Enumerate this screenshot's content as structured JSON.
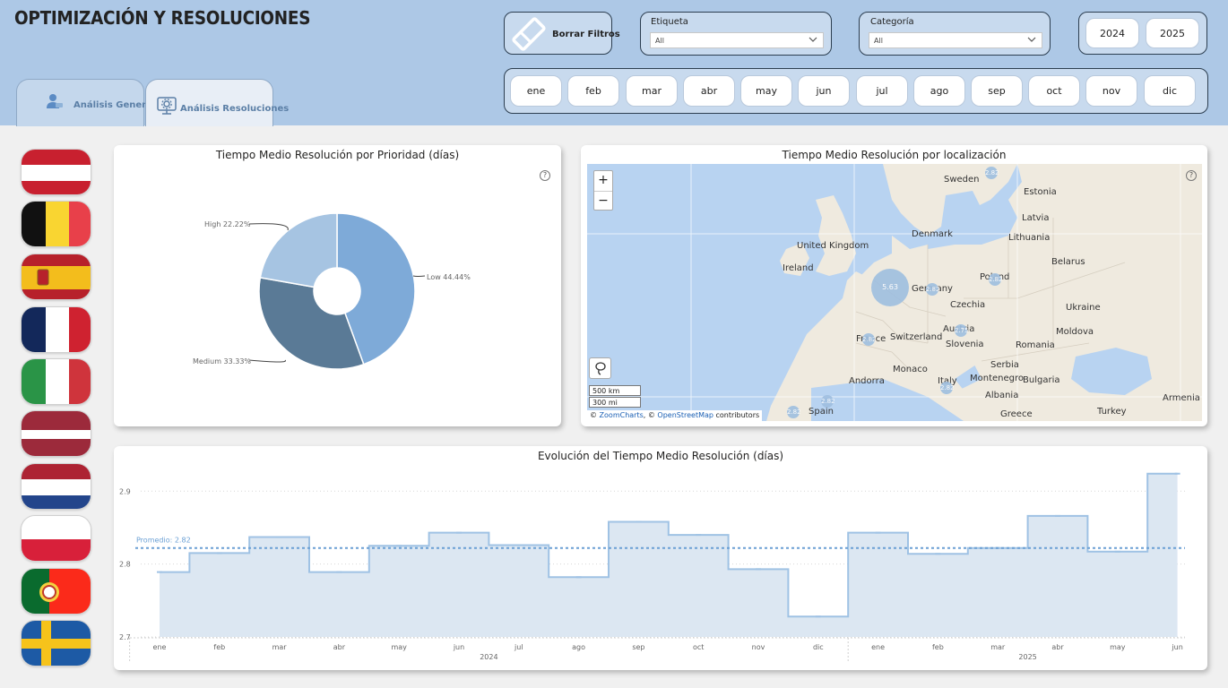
{
  "header": {
    "title": "OPTIMIZACIÓN Y RESOLUCIONES",
    "tabs": [
      {
        "label": "Análisis General",
        "active": false
      },
      {
        "label": "Análisis Resoluciones",
        "active": true
      }
    ],
    "clear_filters_label": "Borrar Filtros",
    "etiqueta": {
      "label": "Etiqueta",
      "value": "All"
    },
    "categoria": {
      "label": "Categoría",
      "value": "All"
    },
    "years": [
      "2024",
      "2025"
    ],
    "months": [
      "ene",
      "feb",
      "mar",
      "abr",
      "may",
      "jun",
      "jul",
      "ago",
      "sep",
      "oct",
      "nov",
      "dic"
    ]
  },
  "flags": [
    "austria-flag",
    "belgium-flag",
    "spain-flag",
    "france-flag",
    "italy-flag",
    "latvia-flag",
    "netherlands-flag",
    "poland-flag",
    "portugal-flag",
    "sweden-flag"
  ],
  "colors": {
    "header_bg": "#adc8e6",
    "low": "#7eaad8",
    "medium": "#5a7a96",
    "high": "#a6c4e2",
    "line": "#9fc2e4",
    "area": "#dce7f2",
    "avg": "#6a9fd4"
  },
  "donut": {
    "title": "Tiempo Medio Resolución por Prioridad (días)",
    "slices": [
      {
        "label": "Low 44.44%",
        "name": "Low",
        "value": 44.44,
        "color": "#7eaad8"
      },
      {
        "label": "Medium 33.33%",
        "name": "Medium",
        "value": 33.33,
        "color": "#5a7a96"
      },
      {
        "label": "High 22.22%",
        "name": "High",
        "value": 22.22,
        "color": "#a6c4e2"
      }
    ]
  },
  "map": {
    "title": "Tiempo Medio Resolución por localización",
    "zoom_in": "+",
    "zoom_out": "−",
    "scale_km": "500 km",
    "scale_mi": "300 mi",
    "attribution": {
      "prefix": "© ",
      "zoomcharts": "ZoomCharts",
      "sep": ", © ",
      "osm": "OpenStreetMap",
      "suffix": " contributors"
    },
    "countries": [
      "Sweden",
      "Estonia",
      "Latvia",
      "Denmark",
      "Lithuania",
      "United Kingdom",
      "Ireland",
      "Belarus",
      "Poland",
      "Germany",
      "Czechia",
      "Ukraine",
      "France",
      "Switzerland",
      "Austria",
      "Slovenia",
      "Moldova",
      "Romania",
      "Monaco",
      "Serbia",
      "Andorra",
      "Italy",
      "Montenegro",
      "Bulgaria",
      "Albania",
      "Spain",
      "Greece",
      "Turkey",
      "Armenia"
    ],
    "bubbles": [
      {
        "name": "bubble-belgium",
        "value": "5.63"
      },
      {
        "name": "bubble-sweden",
        "value": "2.82"
      },
      {
        "name": "bubble-germany",
        "value": "2.82"
      },
      {
        "name": "bubble-poland",
        "value": "2.82"
      },
      {
        "name": "bubble-france",
        "value": "2.82"
      },
      {
        "name": "bubble-austria",
        "value": "2.75"
      },
      {
        "name": "bubble-italy",
        "value": "2.82"
      },
      {
        "name": "bubble-spain",
        "value": "2.82"
      },
      {
        "name": "bubble-portugal",
        "value": "2.82"
      }
    ]
  },
  "chart_data": {
    "type": "area",
    "title": "Evolución del Tiempo Medio Resolución (días)",
    "categories": [
      "ene",
      "feb",
      "mar",
      "abr",
      "may",
      "jun",
      "jul",
      "ago",
      "sep",
      "oct",
      "nov",
      "dic",
      "ene",
      "feb",
      "mar",
      "abr",
      "may",
      "jun"
    ],
    "groups": [
      {
        "label": "2024",
        "count": 12
      },
      {
        "label": "2025",
        "count": 6
      }
    ],
    "values": [
      2.789,
      2.815,
      2.837,
      2.789,
      2.825,
      2.843,
      2.826,
      2.782,
      2.858,
      2.84,
      2.793,
      2.728,
      2.843,
      2.814,
      2.822,
      2.866,
      2.817,
      2.924
    ],
    "average": 2.822,
    "average_label": "Promedio: 2.82",
    "y_ticks": [
      "2.7",
      "2.8",
      "2.9"
    ],
    "ylim": [
      2.7,
      2.92
    ],
    "step": true,
    "grid": true
  }
}
